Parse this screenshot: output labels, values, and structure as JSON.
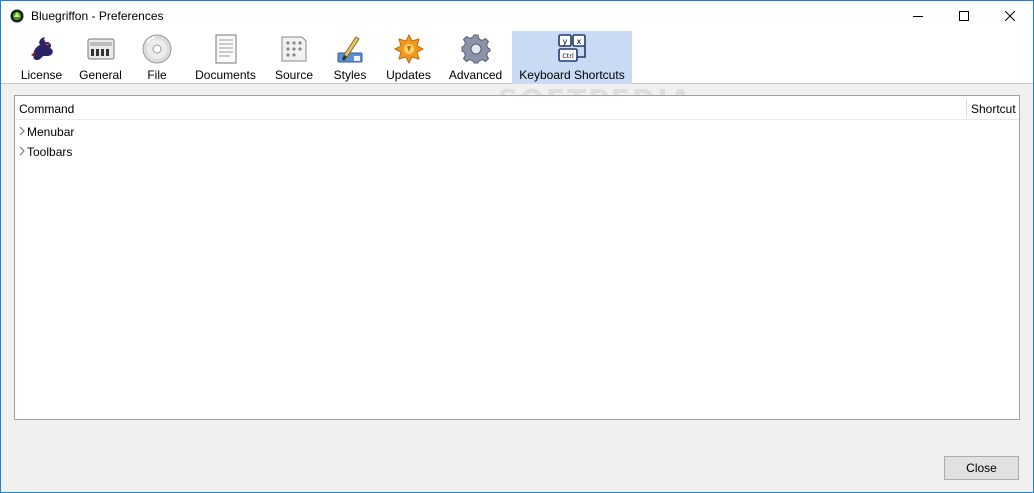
{
  "window": {
    "title": "Bluegriffon - Preferences"
  },
  "tabs": [
    {
      "label": "License",
      "icon": "griffon-icon"
    },
    {
      "label": "General",
      "icon": "panel-icon"
    },
    {
      "label": "File",
      "icon": "disc-icon"
    },
    {
      "label": "Documents",
      "icon": "document-icon"
    },
    {
      "label": "Source",
      "icon": "source-icon"
    },
    {
      "label": "Styles",
      "icon": "brush-icon"
    },
    {
      "label": "Updates",
      "icon": "updates-icon"
    },
    {
      "label": "Advanced",
      "icon": "gear-icon"
    },
    {
      "label": "Keyboard Shortcuts",
      "icon": "keyboard-icon",
      "selected": true
    }
  ],
  "keyboard_icon_keys": [
    "y",
    "x",
    "Ctrl"
  ],
  "table": {
    "columns": [
      "Command",
      "Shortcut"
    ],
    "rows": [
      "Menubar",
      "Toolbars"
    ]
  },
  "watermark": "SOFTPEDIA",
  "footer": {
    "close_label": "Close"
  },
  "colors": {
    "selected_tab": "#c8daf4",
    "window_border": "#1883d7"
  }
}
